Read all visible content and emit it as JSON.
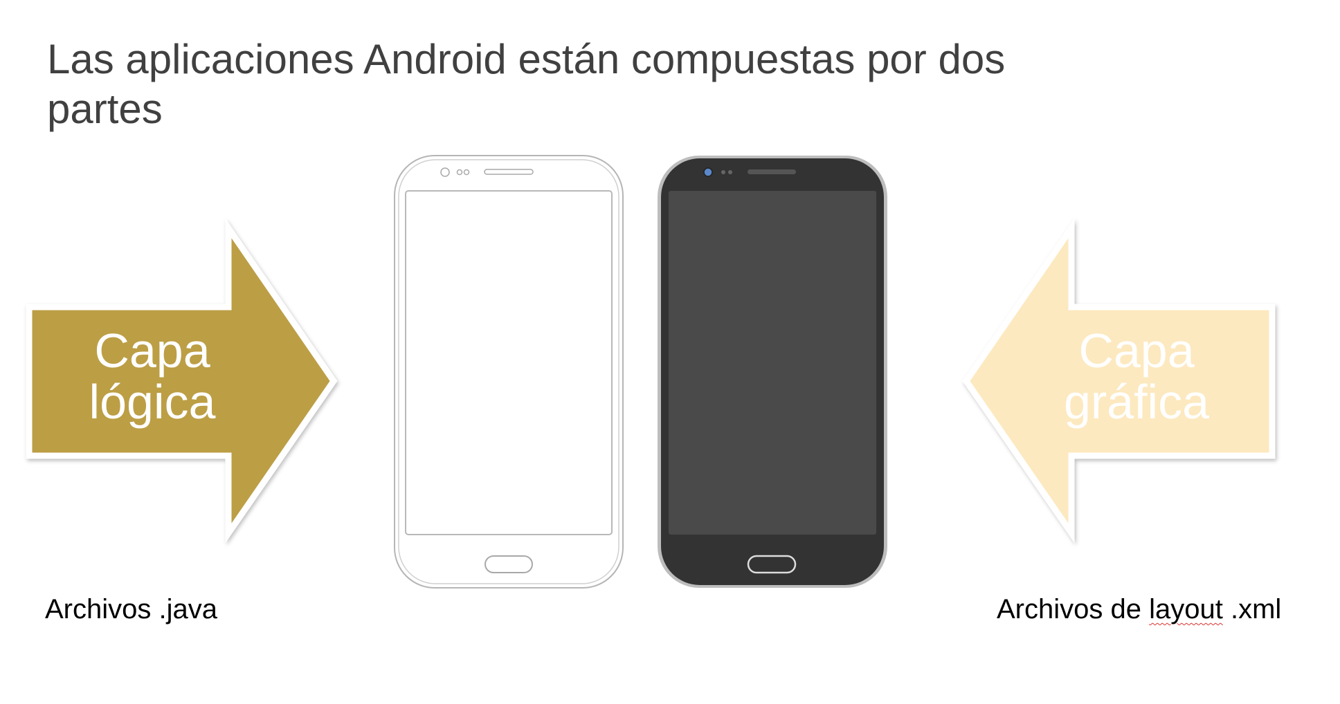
{
  "slide": {
    "title_line1": "Las aplicaciones Android están compuestas por dos",
    "title_line2": "partes"
  },
  "left_arrow": {
    "label_line1": "Capa",
    "label_line2": "lógica",
    "color": "#bc9e44"
  },
  "right_arrow": {
    "label_line1": "Capa",
    "label_line2": "gráfica",
    "color": "#fde9c0"
  },
  "captions": {
    "left": "Archivos .java",
    "right_prefix": "Archivos de ",
    "right_word": "layout",
    "right_suffix": " .xml"
  },
  "phones": {
    "outline_phone": "white-outline-smartphone",
    "dark_phone": "dark-smartphone"
  }
}
